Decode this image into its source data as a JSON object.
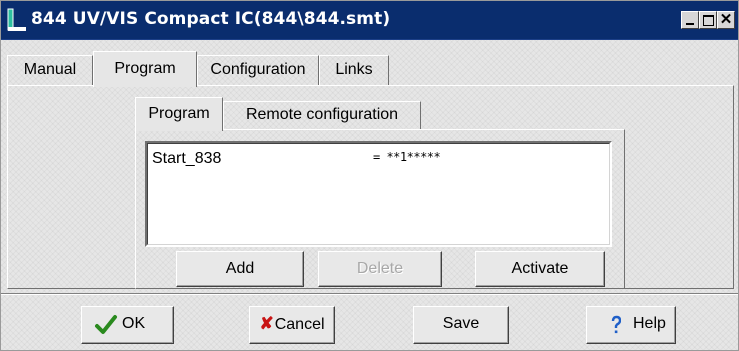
{
  "window": {
    "title": "844 UV/VIS Compact IC(844\\844.smt)",
    "controls": {
      "minimize": "_",
      "maximize": "□",
      "close": "✕"
    }
  },
  "main_tabs": [
    {
      "label": "Manual",
      "active": false
    },
    {
      "label": "Program",
      "active": true
    },
    {
      "label": "Configuration",
      "active": false
    },
    {
      "label": "Links",
      "active": false
    }
  ],
  "sub_tabs": [
    {
      "label": "Program",
      "active": true
    },
    {
      "label": "Remote configuration",
      "active": false
    }
  ],
  "program_list": [
    {
      "name": "Start_838",
      "value": "= **1*****"
    }
  ],
  "program_buttons": {
    "add": "Add",
    "delete": "Delete",
    "activate": "Activate"
  },
  "dialog_buttons": {
    "ok": "OK",
    "cancel": "Cancel",
    "save": "Save",
    "help": "Help"
  },
  "icons": {
    "app": "instrument-icon",
    "ok": "checkmark-icon",
    "cancel": "cross-icon",
    "help": "question-mark-icon"
  },
  "colors": {
    "titlebar": "#0a2d6e",
    "checkmark": "#2a8a1e",
    "cancel_x": "#c81414",
    "help_q": "#1f5fc8"
  }
}
